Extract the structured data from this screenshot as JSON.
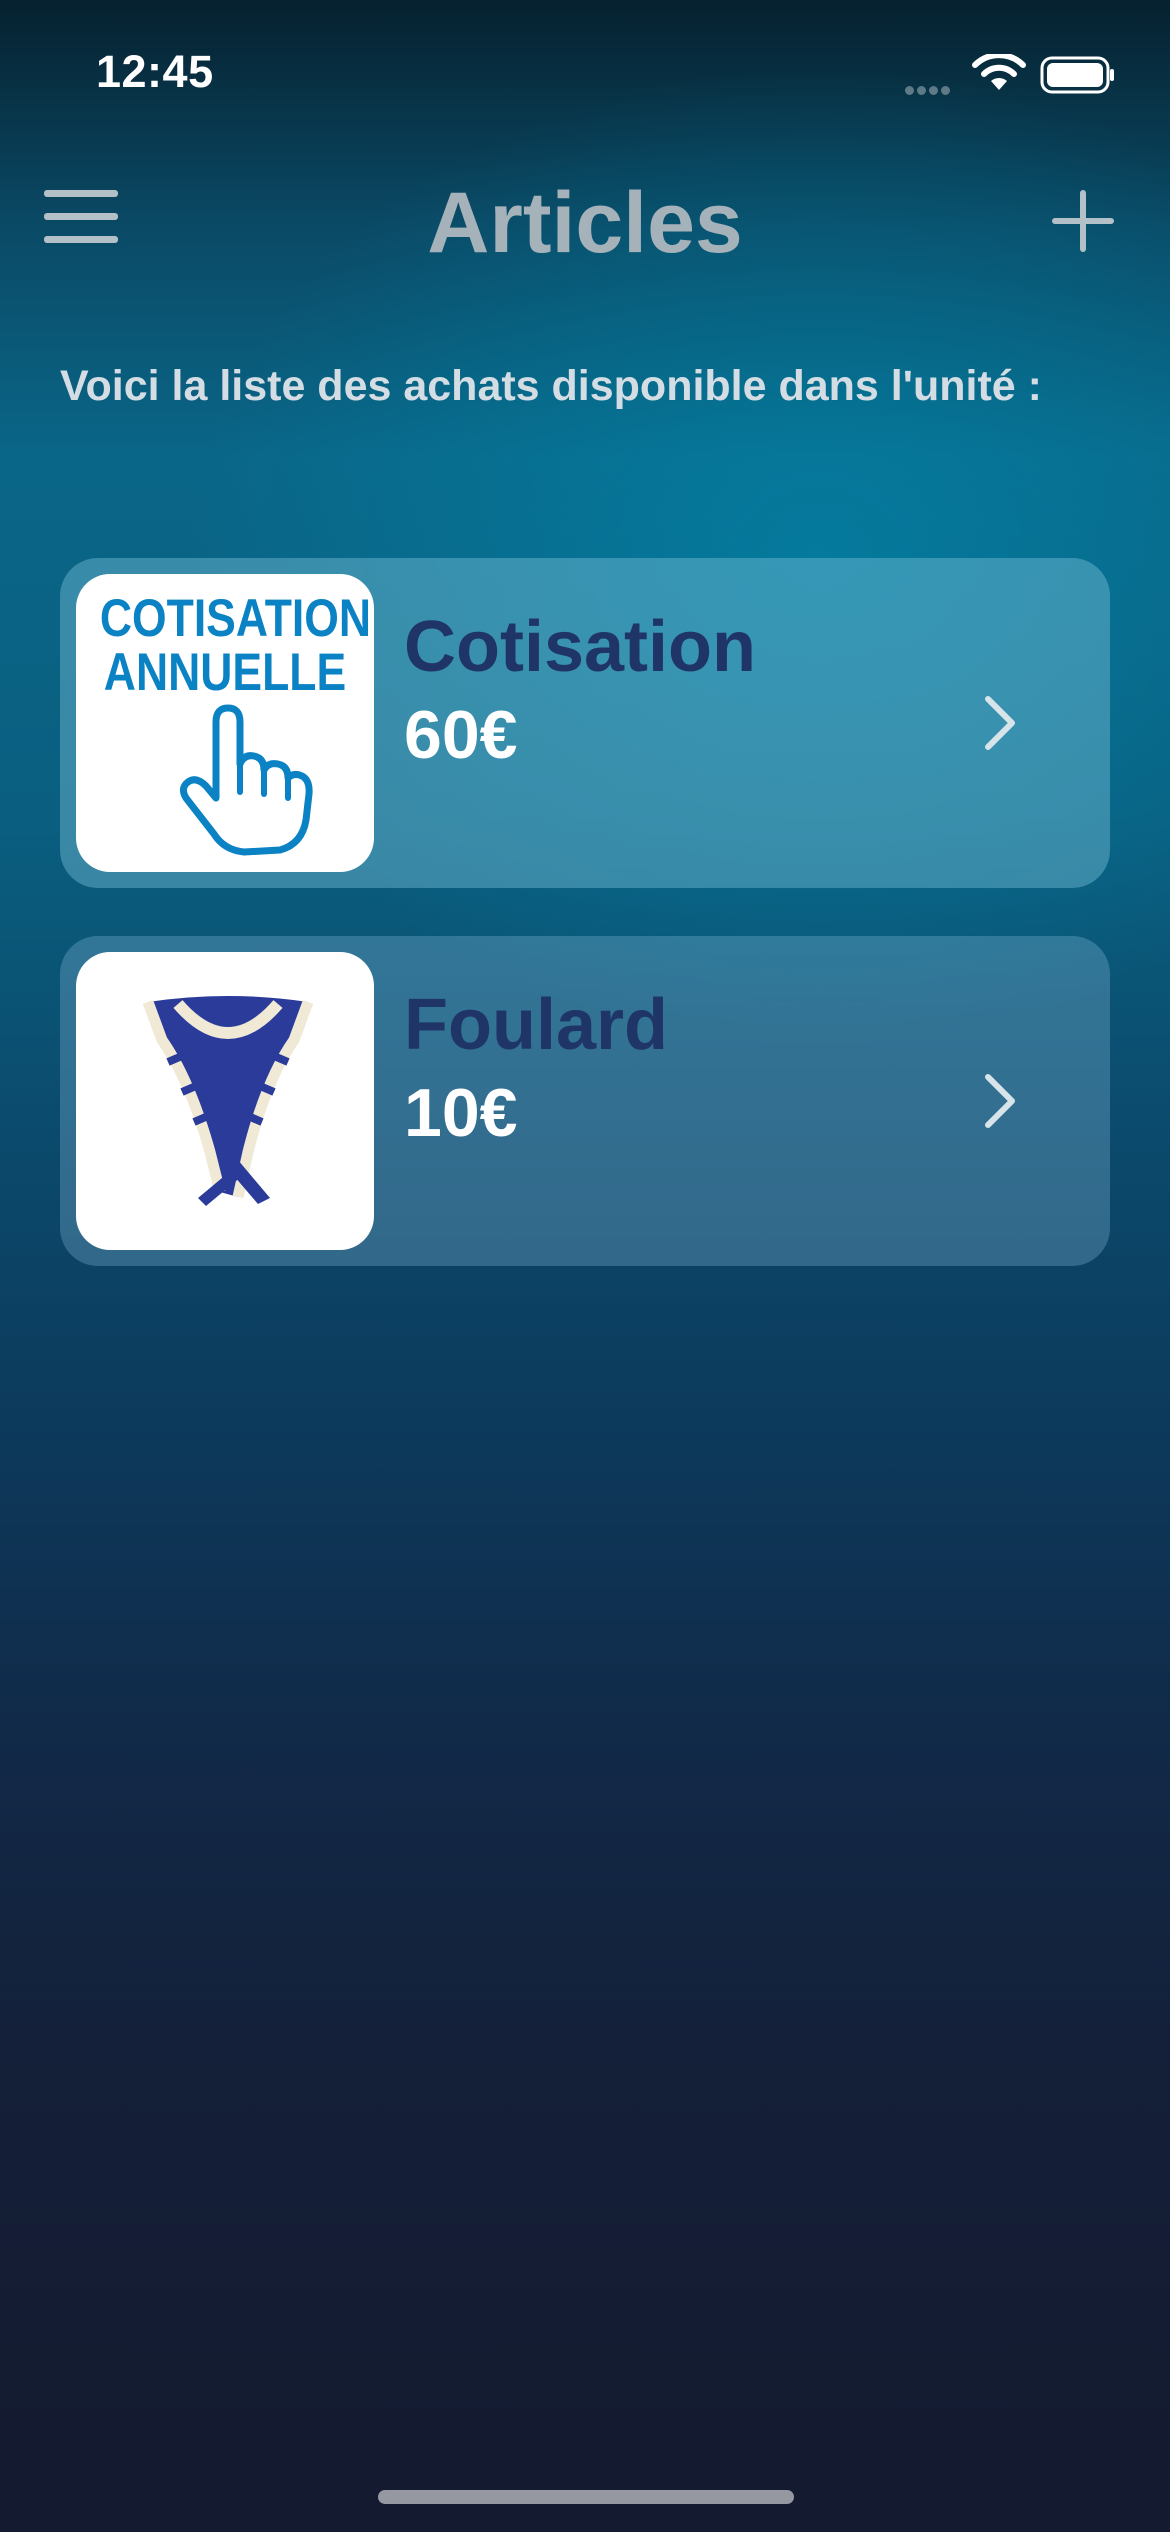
{
  "status_bar": {
    "time": "12:45"
  },
  "nav": {
    "title": "Articles"
  },
  "intro": {
    "text": "Voici la liste des achats disponible dans l'unité :"
  },
  "articles": [
    {
      "name": "Cotisation",
      "price": "60€",
      "image_text_line1": "COTISATION",
      "image_text_line2": "ANNUELLE"
    },
    {
      "name": "Foulard",
      "price": "10€"
    }
  ],
  "colors": {
    "accent_blue": "#0a82c4",
    "item_name": "#1f3567",
    "scarf_blue": "#2b3b9a",
    "scarf_cream": "#efe9d6"
  }
}
